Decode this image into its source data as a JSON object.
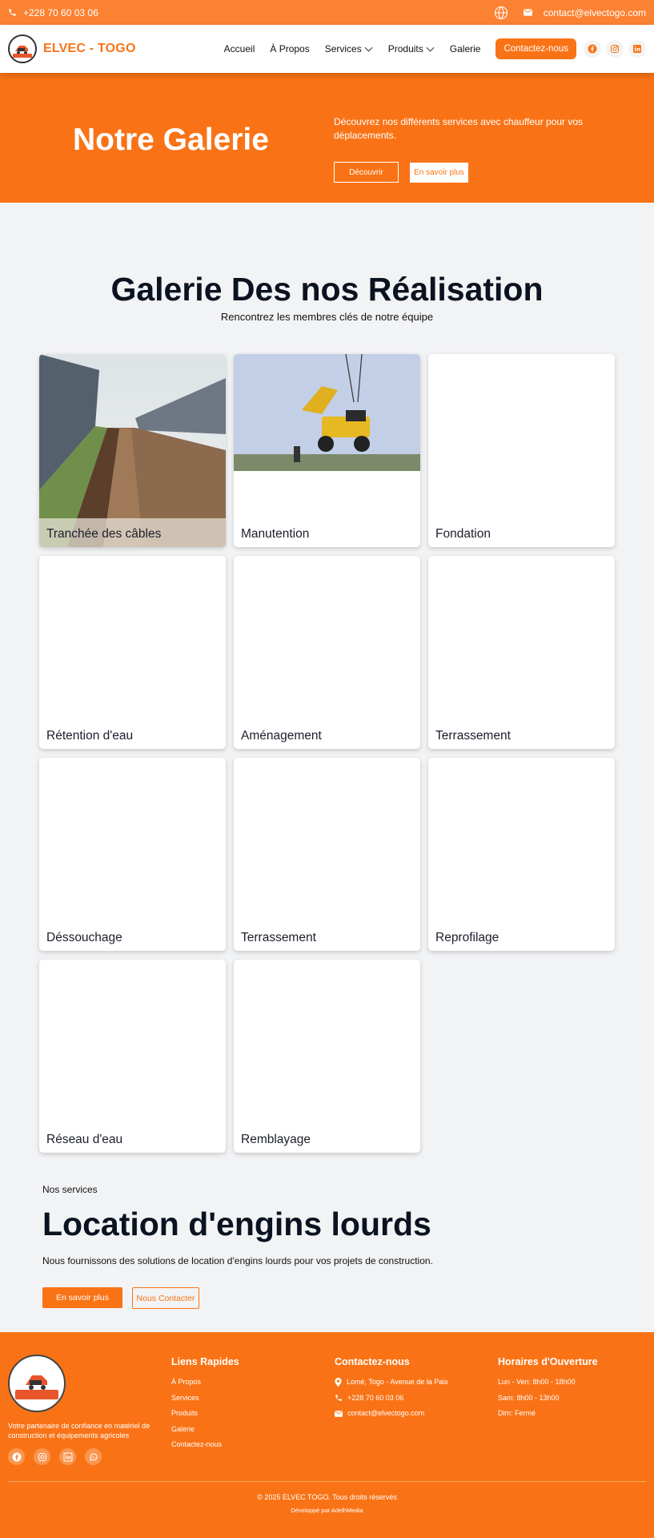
{
  "topbar": {
    "phone": "+228 70 60 03 06",
    "email": "contact@elvectogo.com"
  },
  "header": {
    "brand": "ELVEC - TOGO",
    "logo_text": "ELVEC TOGO",
    "nav": [
      "Accueil",
      "À Propos",
      "Services",
      "Produits",
      "Galerie"
    ],
    "contact_button": "Contactez-nous"
  },
  "hero": {
    "title": "Notre Galerie",
    "description": "Découvrez nos différents services avec chauffeur pour vos déplacements.",
    "button_discover": "Découvrir",
    "button_more": "En savoir plus"
  },
  "gallery": {
    "title": "Galerie Des nos Réalisation",
    "subtitle": "Rencontrez les membres clés de notre équipe",
    "items": [
      "Tranchée des câbles",
      "Manutention",
      "Fondation",
      "Rétention d'eau",
      "Aménagement",
      "Terrassement",
      "Déssouchage",
      "Terrassement",
      "Reprofilage",
      "Réseau d'eau",
      "Remblayage"
    ]
  },
  "services_promo": {
    "kicker": "Nos services",
    "title": "Location d'engins lourds",
    "description": "Nous fournissons des solutions de location d'engins lourds pour vos projets de construction.",
    "button_more": "En savoir plus",
    "button_contact": "Nous Contacter"
  },
  "footer": {
    "logo_text": "ELVEC TOGO",
    "tagline": "Votre partenaire de confiance en matériel de construction et équipements agricoles",
    "links_title": "Liens Rapides",
    "links": [
      "À Propos",
      "Services",
      "Produits",
      "Galerie",
      "Contactez-nous"
    ],
    "contact_title": "Contactez-nous",
    "address": "Lomé, Togo - Avenue de la Paix",
    "phone": "+228 70 60 03 06",
    "email": "contact@elvectogo.com",
    "hours_title": "Horaires d'Ouverture",
    "hours": [
      "Lun - Ven: 8h00 - 18h00",
      "Sam: 8h00 - 13h00",
      "Dim: Fermé"
    ],
    "copyright": "© 2025 ELVEC TOGO. Tous droits réservés",
    "developer": "Développé par AdelhMedia"
  },
  "colors": {
    "brand_orange": "#f97316",
    "topbar_orange": "#fb8232",
    "background": "#f2f3f5"
  },
  "icons": [
    "phone-icon",
    "mail-icon",
    "globe-icon",
    "chevron-down-icon",
    "facebook-icon",
    "instagram-icon",
    "linkedin-icon",
    "whatsapp-icon",
    "map-pin-icon"
  ]
}
